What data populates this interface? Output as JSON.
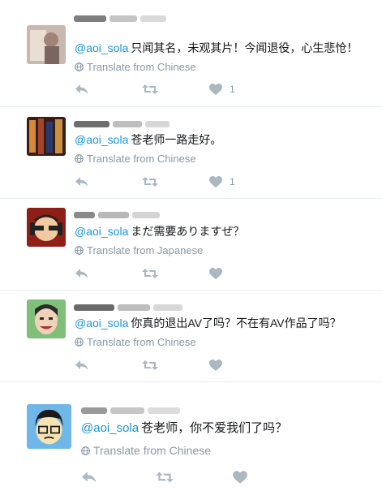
{
  "tweets": [
    {
      "handle": "@aoi_sola",
      "text": "只闻其名，未观其片！今闻退役，心生悲怆！",
      "translate": "Translate from Chinese",
      "like_count": "1",
      "avatar_colors": [
        "#b9a7a0",
        "#e6dad2",
        "#7a6660"
      ]
    },
    {
      "handle": "@aoi_sola",
      "text": "苍老师一路走好。",
      "translate": "Translate from Chinese",
      "like_count": "1",
      "avatar_colors": [
        "#6b2e1c",
        "#d38a3a",
        "#2b3a6a"
      ]
    },
    {
      "handle": "@aoi_sola",
      "text": "まだ需要ありますぜ？",
      "translate": "Translate from Japanese",
      "like_count": "",
      "avatar_colors": [
        "#c0392b",
        "#f2c9a0",
        "#222222"
      ]
    },
    {
      "handle": "@aoi_sola",
      "text": "你真的退出AV了吗？不在有AV作品了吗？",
      "translate": "Translate from Chinese",
      "like_count": "",
      "avatar_colors": [
        "#7fbf7a",
        "#f0d2b8",
        "#2a2a2a"
      ]
    },
    {
      "handle": "@aoi_sola",
      "text": "苍老师，你不爱我们了吗？",
      "translate": "Translate from Chinese",
      "like_count": "",
      "avatar_colors": [
        "#6fb7e8",
        "#f7e3b2",
        "#1a1a1a"
      ]
    }
  ],
  "icons": {
    "reply": "reply-icon",
    "retweet": "retweet-icon",
    "like": "heart-icon",
    "translate": "globe-icon"
  },
  "colors": {
    "link": "#1b95e0",
    "muted": "#8899a6",
    "icon": "#aab8c2",
    "divider": "#e6ecf0"
  }
}
